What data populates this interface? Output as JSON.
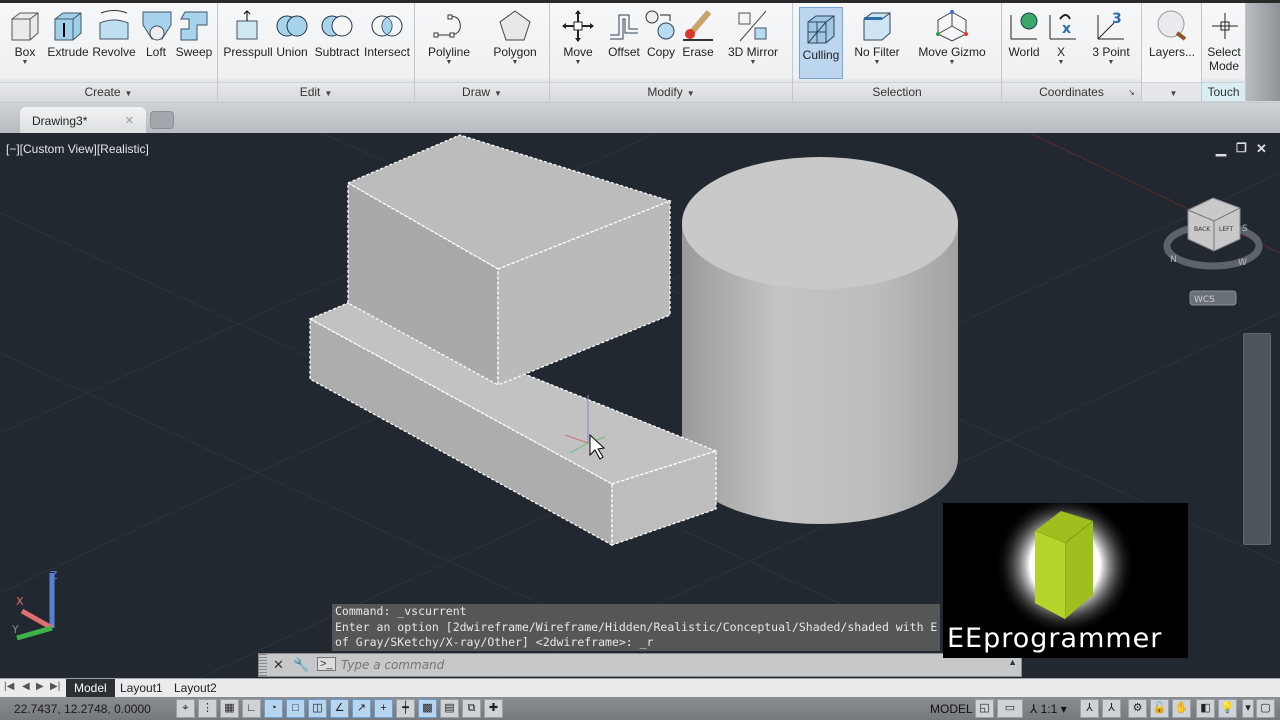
{
  "ribbon": {
    "panels": [
      {
        "title": "Create",
        "has_menu": true,
        "tools": [
          {
            "label": "Box",
            "icon": "box-icon",
            "dropdown": true
          },
          {
            "label": "Extrude",
            "icon": "extrude-icon",
            "dropdown": false
          },
          {
            "label": "Revolve",
            "icon": "revolve-icon",
            "dropdown": false
          },
          {
            "label": "Loft",
            "icon": "loft-icon",
            "dropdown": false
          },
          {
            "label": "Sweep",
            "icon": "sweep-icon",
            "dropdown": false
          }
        ]
      },
      {
        "title": "Edit",
        "has_menu": true,
        "tools": [
          {
            "label": "Presspull",
            "icon": "presspull-icon"
          },
          {
            "label": "Union",
            "icon": "union-icon"
          },
          {
            "label": "Subtract",
            "icon": "subtract-icon"
          },
          {
            "label": "Intersect",
            "icon": "intersect-icon"
          }
        ]
      },
      {
        "title": "Draw",
        "has_menu": true,
        "tools": [
          {
            "label": "Polyline",
            "icon": "polyline-icon",
            "dropdown": true
          },
          {
            "label": "Polygon",
            "icon": "polygon-icon",
            "dropdown": true
          }
        ]
      },
      {
        "title": "Modify",
        "has_menu": true,
        "tools": [
          {
            "label": "Move",
            "icon": "move-icon",
            "dropdown": true
          },
          {
            "label": "Offset",
            "icon": "offset-icon"
          },
          {
            "label": "Copy",
            "icon": "copy-icon"
          },
          {
            "label": "Erase",
            "icon": "erase-icon"
          },
          {
            "label": "3D Mirror",
            "icon": "3d-mirror-icon",
            "dropdown": true
          }
        ]
      },
      {
        "title": "Selection",
        "tools": [
          {
            "label": "Culling",
            "icon": "culling-icon",
            "active": true
          },
          {
            "label": "No Filter",
            "icon": "no-filter-icon",
            "dropdown": true
          },
          {
            "label": "Move Gizmo",
            "icon": "move-gizmo-icon",
            "dropdown": true
          }
        ]
      },
      {
        "title": "Coordinates",
        "tools": [
          {
            "label": "World",
            "icon": "world-ucs-icon"
          },
          {
            "label": "X",
            "icon": "x-rotate-ucs-icon",
            "dropdown": true
          },
          {
            "label": "3 Point",
            "icon": "3-point-ucs-icon",
            "dropdown": true
          }
        ]
      },
      {
        "title": "",
        "tools": [
          {
            "label": "Layers...",
            "icon": "layers-icon"
          }
        ]
      },
      {
        "title": "Touch",
        "tools": [
          {
            "label": "Select Mode",
            "icon": "select-mode-icon"
          }
        ]
      }
    ]
  },
  "tabs": {
    "document": "Drawing3*"
  },
  "viewport": {
    "label": "[−][Custom View][Realistic]",
    "viewcube": {
      "faces": [
        "BACK",
        "LEFT"
      ],
      "compass": [
        "N",
        "S",
        "W"
      ],
      "ucs_label": "WCS"
    },
    "ucs_axes": [
      "X",
      "Y",
      "Z"
    ]
  },
  "command": {
    "history": [
      "Command: _vscurrent",
      "Enter an option [2dwireframe/Wireframe/Hidden/Realistic/Conceptual/Shaded/shaded with E",
      "of Gray/SKetchy/X-ray/Other] <2dwireframe>: _r"
    ],
    "placeholder": "Type a command"
  },
  "watermark": {
    "text": "EEprogrammer"
  },
  "layout_tabs": [
    "Model",
    "Layout1",
    "Layout2"
  ],
  "status": {
    "coordinates": "22.7437, 12.2748, 0.0000",
    "space": "MODEL",
    "scale": "1:1"
  }
}
